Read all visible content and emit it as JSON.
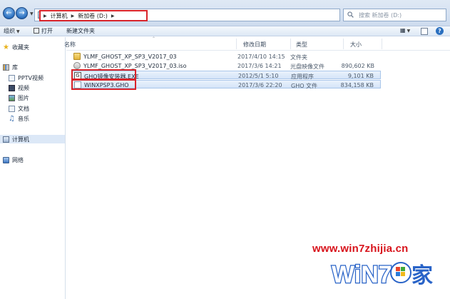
{
  "address_bar": {
    "breadcrumbs": [
      "计算机",
      "新加卷 (D:)"
    ],
    "search_placeholder": "搜索 新加卷 (D:)"
  },
  "toolbar": {
    "organize_label": "组织",
    "open_label": "打开",
    "new_folder_label": "新建文件夹"
  },
  "nav_pane": {
    "favorites": "收藏夹",
    "libraries": "库",
    "library_items": [
      "PPTV视频",
      "视频",
      "图片",
      "文档",
      "音乐"
    ],
    "computer": "计算机",
    "network": "网络"
  },
  "columns": {
    "name": "名称",
    "date_modified": "修改日期",
    "type": "类型",
    "size": "大小"
  },
  "files": [
    {
      "name": "YLMF_GHOST_XP_SP3_V2017_03",
      "date": "2017/4/10 14:15",
      "type": "文件夹",
      "size": "",
      "icon": "folder-icon",
      "selected": false
    },
    {
      "name": "YLMF_GHOST_XP_SP3_V2017_03.iso",
      "date": "2017/3/6 14:21",
      "type": "光盘映像文件",
      "size": "890,602 KB",
      "icon": "disc-image-icon",
      "selected": false
    },
    {
      "name": "GHO镜像安装器.EXE",
      "date": "2012/5/1 5:10",
      "type": "应用程序",
      "size": "9,101 KB",
      "icon": "exe-icon",
      "selected": true
    },
    {
      "name": "WINXPSP3.GHO",
      "date": "2017/3/6 22:20",
      "type": "GHO 文件",
      "size": "834,158 KB",
      "icon": "gho-file-icon",
      "selected": true
    }
  ],
  "watermark": {
    "url": "www.win7zhijia.cn",
    "logo_text": "WiN7",
    "logo_char": "家"
  },
  "colors": {
    "highlight_red": "#d8232a",
    "selection_blue": "#d4e4f8",
    "watermark_red": "#d8141c",
    "logo_blue": "#2a64c8"
  }
}
